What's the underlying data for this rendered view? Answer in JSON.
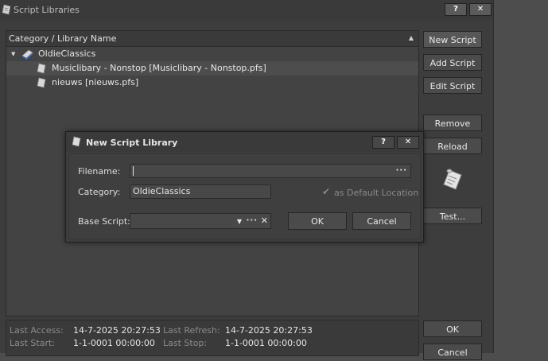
{
  "window": {
    "title": "Script Libraries",
    "help_label": "?",
    "close_label": "✕"
  },
  "tree": {
    "header": "Category / Library Name",
    "category": {
      "name": "OldieClassics",
      "expander": "▼"
    },
    "items": [
      {
        "label": "Musiclibary - Nonstop [Musiclibary - Nonstop.pfs]"
      },
      {
        "label": "nieuws [nieuws.pfs]"
      }
    ]
  },
  "side_buttons": {
    "new_script": "New Script",
    "add_script": "Add Script",
    "edit_script": "Edit Script",
    "remove": "Remove",
    "reload": "Reload",
    "test": "Test...",
    "ok": "OK",
    "cancel": "Cancel"
  },
  "status": {
    "last_access_label": "Last Access:",
    "last_access_value": "14-7-2025 20:27:53",
    "last_refresh_label": "Last Refresh:",
    "last_refresh_value": "14-7-2025 20:27:53",
    "last_start_label": "Last Start:",
    "last_start_value": "1-1-0001 00:00:00",
    "last_stop_label": "Last Stop:",
    "last_stop_value": "1-1-0001 00:00:00"
  },
  "dialog": {
    "title": "New Script Library",
    "help_label": "?",
    "close_label": "✕",
    "filename_label": "Filename:",
    "filename_value": "",
    "browse_label": "···",
    "category_label": "Category:",
    "category_value": "OldieClassics",
    "default_location_label": "as Default Location",
    "default_location_checked": true,
    "base_script_label": "Base Script:",
    "base_script_value": "",
    "ok_label": "OK",
    "cancel_label": "Cancel"
  }
}
